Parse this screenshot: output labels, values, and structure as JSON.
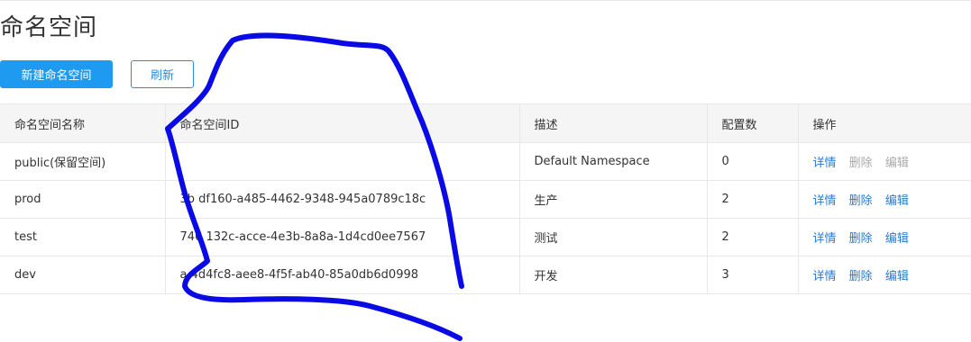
{
  "page": {
    "title": "命名空间"
  },
  "toolbar": {
    "create_label": "新建命名空间",
    "refresh_label": "刷新"
  },
  "table": {
    "headers": {
      "name": "命名空间名称",
      "id": "命名空间ID",
      "desc": "描述",
      "count": "配置数",
      "ops": "操作"
    },
    "rows": [
      {
        "name": "public(保留空间)",
        "id": "",
        "desc": "Default Namespace",
        "count": "0",
        "ops": {
          "detail": "详情",
          "delete": "删除",
          "edit": "编辑",
          "delete_disabled": true,
          "edit_disabled": true
        }
      },
      {
        "name": "prod",
        "id": "3b  df160-a485-4462-9348-945a0789c18c",
        "desc": "生产",
        "count": "2",
        "ops": {
          "detail": "详情",
          "delete": "删除",
          "edit": "编辑",
          "delete_disabled": false,
          "edit_disabled": false
        }
      },
      {
        "name": "test",
        "id": "746  132c-acce-4e3b-8a8a-1d4cd0ee7567",
        "desc": "测试",
        "count": "2",
        "ops": {
          "detail": "详情",
          "delete": "删除",
          "edit": "编辑",
          "delete_disabled": false,
          "edit_disabled": false
        }
      },
      {
        "name": "dev",
        "id": "a  4d4fc8-aee8-4f5f-ab40-85a0db6d0998",
        "desc": "开发",
        "count": "3",
        "ops": {
          "detail": "详情",
          "delete": "删除",
          "edit": "编辑",
          "delete_disabled": false,
          "edit_disabled": false
        }
      }
    ]
  },
  "colors": {
    "primary": "#1e9bf0",
    "link": "#2a7bd0",
    "disabled": "#aaaaaa",
    "header_bg": "#f5f5f5",
    "scribble": "#0a0ae6"
  }
}
